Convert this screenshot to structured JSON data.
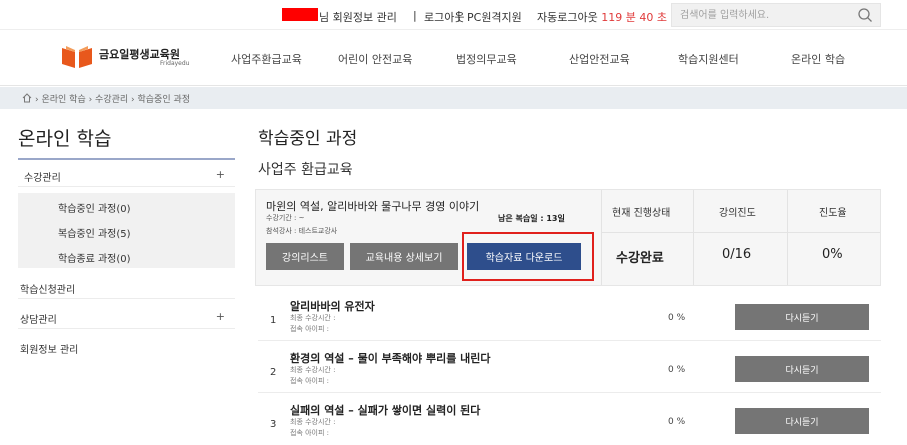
{
  "topbar": {
    "user_text": "님 회원정보 관리",
    "sep1": "|",
    "logout": "로그아웃",
    "sep2": "|",
    "pc_support": "PC원격지원",
    "auto_logout_prefix": "자동로그아웃",
    "auto_logout_time": "119 분 40 초",
    "search_placeholder": "검색어를 입력하세요.",
    "redaction_color": "#ff0000"
  },
  "header": {
    "logo_title": "금요일평생교육원",
    "logo_sub": "Fridayedu",
    "nav": [
      "사업주환급교육",
      "어린이 안전교육",
      "법정의무교육",
      "산업안전교육",
      "학습지원센터",
      "온라인 학습"
    ]
  },
  "breadcrumb": {
    "path": "› 온라인 학습 › 수강관리 › 학습중인 과정"
  },
  "sidebar": {
    "title": "온라인 학습",
    "items": [
      {
        "label": "수강관리",
        "plus": "+"
      },
      {
        "label": "학습중인 과정(0)"
      },
      {
        "label": "복습중인 과정(5)"
      },
      {
        "label": "학습종료 과정(0)"
      },
      {
        "label": "학습신청관리"
      },
      {
        "label": "상담관리",
        "plus": "+"
      },
      {
        "label": "회원정보 관리"
      }
    ]
  },
  "main": {
    "title": "학습중인 과정",
    "section": "사업주 환급교육",
    "course": {
      "name": "마윈의 역설, 알리바바와 물구나무 경영 이야기",
      "period": "수강기간 : ~",
      "remain": "남은 복습일 : 13일",
      "teacher": "참석강사 : 테스트교강사",
      "buttons": {
        "lecture_list": "강의리스트",
        "detail": "교육내용 상세보기",
        "download": "학습자료 다운로드"
      },
      "headers": {
        "status": "현재 진행상태",
        "progress": "강의진도",
        "rate": "진도율"
      },
      "values": {
        "status": "수강완료",
        "progress": "0/16",
        "rate": "0%"
      }
    },
    "lessons": [
      {
        "num": "1",
        "title": "알리바바의 유전자",
        "last_time": "최종 수강시간 :",
        "login_id": "접속 아이피 :",
        "pct": "0 %",
        "button": "다시듣기"
      },
      {
        "num": "2",
        "title": "환경의 역설 – 물이 부족해야 뿌리를 내린다",
        "last_time": "최종 수강시간 :",
        "login_id": "접속 아이피 :",
        "pct": "0 %",
        "button": "다시듣기"
      },
      {
        "num": "3",
        "title": "실패의 역설 – 실패가 쌓이면 실력이 된다",
        "last_time": "최종 수강시간 :",
        "login_id": "접속 아이피 :",
        "pct": "0 %",
        "button": "다시듣기"
      }
    ]
  },
  "colors": {
    "primary_button": "#2e4e8c",
    "gray_button": "#757575",
    "highlight_box": "#e0201c",
    "auto_logout": "#e03a3a"
  }
}
